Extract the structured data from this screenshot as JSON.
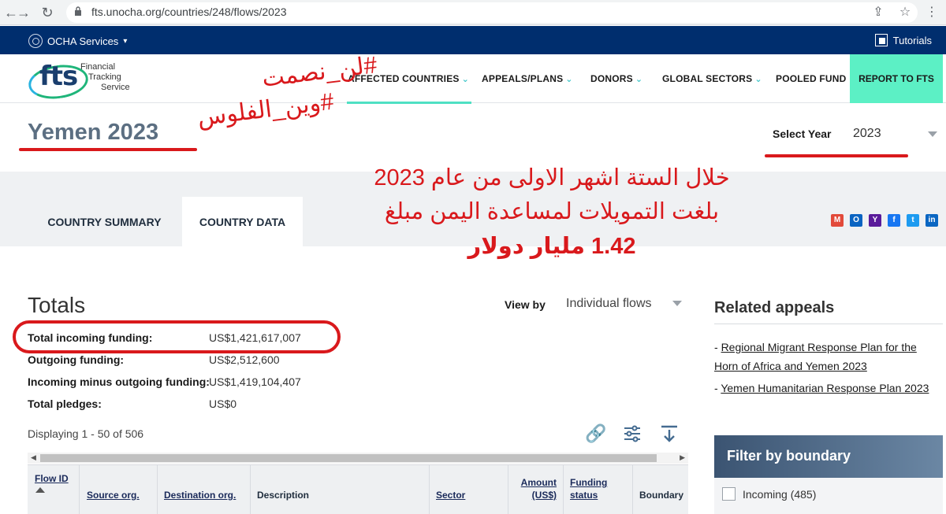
{
  "browser": {
    "url": "fts.unocha.org/countries/248/flows/2023"
  },
  "ocha_bar": {
    "services_label": "OCHA Services",
    "tutorials_label": "Tutorials"
  },
  "logo": {
    "mark": "fts",
    "line1": "Financial",
    "line2": "Tracking",
    "line3": "Service"
  },
  "nav": {
    "affected_countries": "AFFECTED COUNTRIES",
    "appeals_plans": "APPEALS/PLANS",
    "donors": "DONORS",
    "global_sectors": "GLOBAL SECTORS",
    "pooled_fund": "POOLED FUND",
    "report_to_fts": "REPORT TO FTS"
  },
  "page": {
    "title": "Yemen 2023",
    "select_year_label": "Select Year",
    "selected_year": "2023"
  },
  "tabs": {
    "country_summary": "COUNTRY SUMMARY",
    "country_data": "COUNTRY DATA"
  },
  "share": [
    "gmail-icon",
    "outlook-icon",
    "yahoo-icon",
    "facebook-icon",
    "twitter-icon",
    "linkedin-icon"
  ],
  "totals": {
    "title": "Totals",
    "view_by_label": "View by",
    "view_by_value": "Individual flows",
    "rows": [
      {
        "label": "Total incoming funding:",
        "value": "US$1,421,617,007"
      },
      {
        "label": "Outgoing funding:",
        "value": "US$2,512,600"
      },
      {
        "label": "Incoming minus outgoing funding:",
        "value": "US$1,419,104,407"
      },
      {
        "label": "Total pledges:",
        "value": "US$0"
      }
    ],
    "displaying": "Displaying 1 - 50 of 506"
  },
  "table": {
    "headers": {
      "flow_id": "Flow ID",
      "source_org": "Source org.",
      "destination_org": "Destination org.",
      "description": "Description",
      "sector": "Sector",
      "amount_line1": "Amount",
      "amount_line2": "(US$)",
      "funding_line1": "Funding",
      "funding_line2": "status",
      "boundary": "Boundary"
    }
  },
  "sidebar": {
    "related_title": "Related appeals",
    "appeal1_line1": "Regional Migrant Response Plan for the",
    "appeal1_line2": "Horn of Africa and Yemen 2023",
    "appeal2": "Yemen Humanitarian Response Plan 2023",
    "dash": "- ",
    "filter_title": "Filter by boundary",
    "filter_incoming": "Incoming (485)"
  },
  "annotations": {
    "hashtag1": "#لن_نصمت",
    "hashtag2": "#وين_الفلوس",
    "line1": "خلال الستة اشهر الاولى من عام 2023",
    "line2": "بلغت التمويلات لمساعدة اليمن مبلغ",
    "line3": "1.42 مليار دولار"
  },
  "colors": {
    "ocha_blue": "#002e6e",
    "report_green": "#5cf0c5",
    "annotation_red": "#d9191c"
  }
}
